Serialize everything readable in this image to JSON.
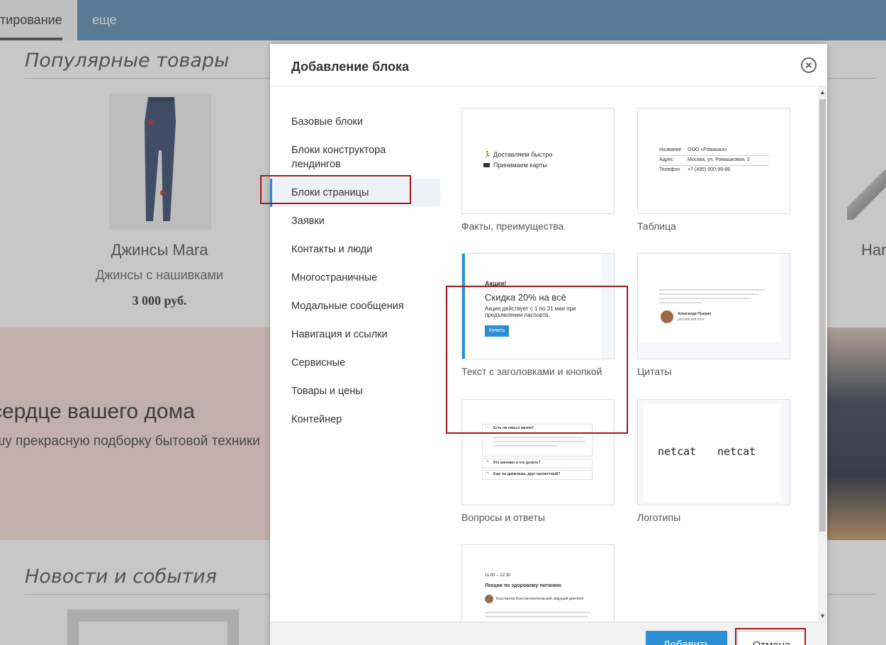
{
  "background": {
    "nav": {
      "active_tab": "тирование",
      "more_tab": "еще"
    },
    "popular_title": "Популярные товары",
    "product": {
      "name": "Джинсы Mara",
      "description": "Джинсы с нашивками",
      "price": "3 000 руб."
    },
    "right_product_name": "Har",
    "banner": {
      "heading": "сердце вашего дома",
      "subheading": "шу прекрасную подборку бытовой техники"
    },
    "news_title": "Новости и события"
  },
  "modal": {
    "title": "Добавление блока",
    "categories": [
      "Базовые блоки",
      "Блоки конструктора лендингов",
      "Блоки страницы",
      "Заявки",
      "Контакты и люди",
      "Многостраничные",
      "Модальные сообщения",
      "Навигация и ссылки",
      "Сервисные",
      "Товары и цены",
      "Контейнер"
    ],
    "active_category": "Блоки страницы",
    "blocks": [
      {
        "label": "Факты, преимущества",
        "preview": {
          "line1": "Доставляем быстро",
          "line2": "Принимаем карты"
        }
      },
      {
        "label": "Таблица",
        "preview": {
          "rows": [
            {
              "k": "Название",
              "v": "ООО «Ромашка»"
            },
            {
              "k": "Адрес",
              "v": "Москва, ул. Ромашковая, 2"
            },
            {
              "k": "Телефон",
              "v": "+7 (495) 000-99-88"
            }
          ]
        }
      },
      {
        "label": "Текст с заголовками и кнопкой",
        "preview": {
          "kicker": "Акция!",
          "headline": "Скидка 20% на всё",
          "body": "Акция действует с 1 по 31 мая при предъявлении паспорта.",
          "button": "Купить"
        }
      },
      {
        "label": "Цитаты",
        "preview": {
          "author": "Александр Пушкин",
          "role": "российский поэт"
        }
      },
      {
        "label": "Вопросы и ответы",
        "preview": {
          "q1": "Есть ли смысл жизни?",
          "q2": "Кто виноват и что делать?",
          "q3": "Еще ты дремлешь, друг прелестный?"
        }
      },
      {
        "label": "Логотипы",
        "preview": {
          "logo1": "netcat",
          "logo2": "netcat"
        }
      },
      {
        "label": "",
        "preview": {
          "time": "11:00 – 12:30",
          "title": "Лекция по здоровому питанию",
          "speaker": "Константин Константинопольский, ведущий диетолог"
        }
      }
    ],
    "buttons": {
      "add": "Добавить",
      "cancel": "Отмена"
    }
  }
}
